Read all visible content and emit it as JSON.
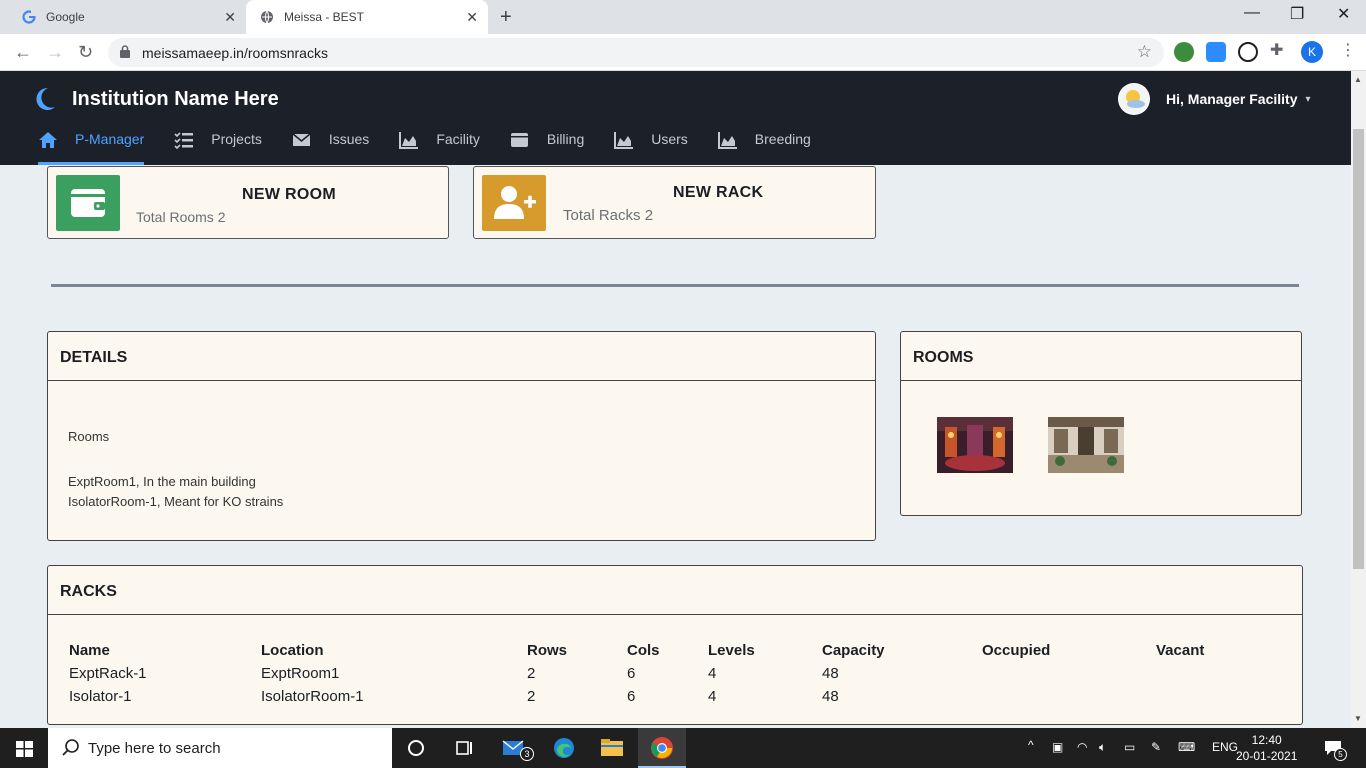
{
  "browser": {
    "tabs": [
      {
        "title": "Google"
      },
      {
        "title": "Meissa - BEST"
      }
    ],
    "url": "meissamaeep.in/roomsnracks",
    "profile_initial": "K"
  },
  "header": {
    "institution": "Institution Name Here",
    "greeting": "Hi, Manager Facility",
    "nav": [
      {
        "label": "P-Manager",
        "icon": "home-icon",
        "active": true
      },
      {
        "label": "Projects",
        "icon": "tasks-icon"
      },
      {
        "label": "Issues",
        "icon": "envelope-icon"
      },
      {
        "label": "Facility",
        "icon": "area-chart-icon"
      },
      {
        "label": "Billing",
        "icon": "wallet-icon"
      },
      {
        "label": "Users",
        "icon": "area-chart-icon"
      },
      {
        "label": "Breeding",
        "icon": "area-chart-icon"
      }
    ]
  },
  "cards": {
    "room": {
      "title": "NEW ROOM",
      "subtitle": "Total Rooms 2",
      "color": "#3a9f5f",
      "icon": "wallet-icon"
    },
    "rack": {
      "title": "NEW RACK",
      "subtitle": "Total Racks 2",
      "color": "#d69a2d",
      "icon": "user-plus-icon"
    }
  },
  "details": {
    "title": "DETAILS",
    "section": "Rooms",
    "rooms": [
      "ExptRoom1, In the main building",
      "IsolatorRoom-1, Meant for KO strains"
    ]
  },
  "rooms_panel": {
    "title": "ROOMS"
  },
  "racks": {
    "title": "RACKS",
    "columns": [
      "Name",
      "Location",
      "Rows",
      "Cols",
      "Levels",
      "Capacity",
      "Occupied",
      "Vacant"
    ],
    "rows": [
      [
        "ExptRack-1",
        "ExptRoom1",
        "2",
        "6",
        "4",
        "48",
        "",
        ""
      ],
      [
        "Isolator-1",
        "IsolatorRoom-1",
        "2",
        "6",
        "4",
        "48",
        "",
        ""
      ]
    ]
  },
  "taskbar": {
    "search_placeholder": "Type here to search",
    "mail_badge": "3",
    "language": "ENG",
    "time": "12:40",
    "date": "20-01-2021",
    "notif_count": "5"
  }
}
